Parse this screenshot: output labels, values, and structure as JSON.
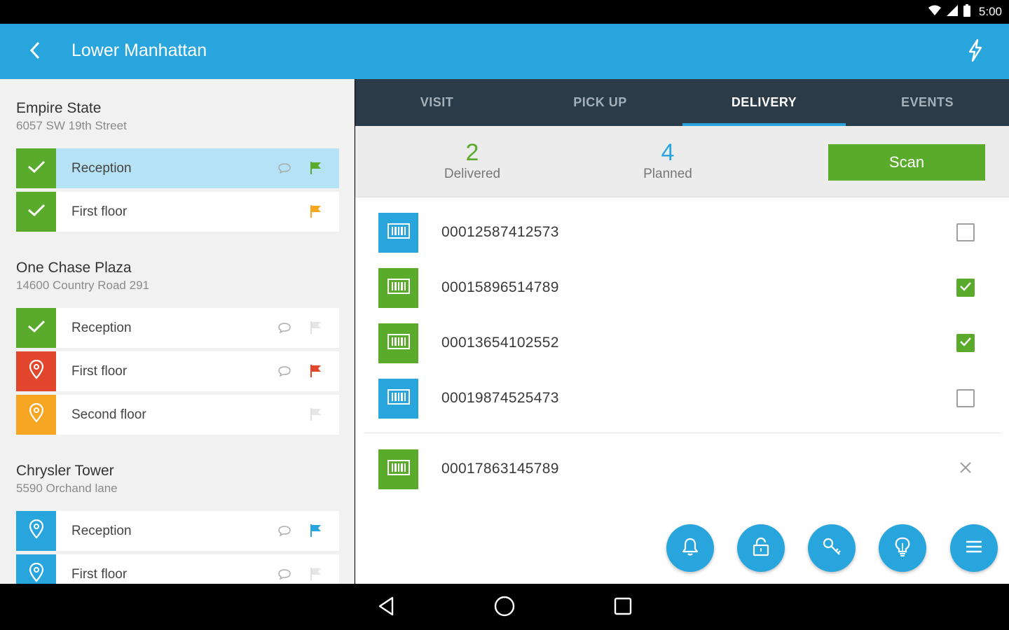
{
  "status_bar": {
    "time": "5:00"
  },
  "app_bar": {
    "title": "Lower Manhattan",
    "back_icon": "chevron-left-icon",
    "action_icon": "bolt-icon"
  },
  "colors": {
    "primary": "#29a5de",
    "success": "#5aaa2b",
    "danger": "#e2462c",
    "warning": "#f6a623",
    "tab_bar": "#2b3b48"
  },
  "locations": [
    {
      "name": "Empire State",
      "address": "6057 SW 19th Street",
      "stops": [
        {
          "label": "Reception",
          "status": "done",
          "comment": true,
          "flag": "green",
          "selected": true
        },
        {
          "label": "First floor",
          "status": "done",
          "comment": false,
          "flag": "orange",
          "selected": false
        }
      ]
    },
    {
      "name": "One Chase Plaza",
      "address": "14600 Country Road 291",
      "stops": [
        {
          "label": "Reception",
          "status": "done",
          "comment": true,
          "flag": "grey",
          "selected": false
        },
        {
          "label": "First floor",
          "status": "red-pin",
          "comment": true,
          "flag": "red",
          "selected": false
        },
        {
          "label": "Second floor",
          "status": "orange-pin",
          "comment": false,
          "flag": "grey",
          "selected": false
        }
      ]
    },
    {
      "name": "Chrysler Tower",
      "address": "5590 Orchand lane",
      "stops": [
        {
          "label": "Reception",
          "status": "blue-pin",
          "comment": true,
          "flag": "blue",
          "selected": false
        },
        {
          "label": "First floor",
          "status": "blue-pin",
          "comment": true,
          "flag": "grey",
          "selected": false
        }
      ]
    }
  ],
  "tabs": [
    {
      "label": "VISIT",
      "active": false
    },
    {
      "label": "PICK UP",
      "active": false
    },
    {
      "label": "DELIVERY",
      "active": true
    },
    {
      "label": "EVENTS",
      "active": false
    }
  ],
  "summary": {
    "delivered_count": "2",
    "delivered_label": "Delivered",
    "planned_count": "4",
    "planned_label": "Planned",
    "scan_label": "Scan"
  },
  "parcels": [
    {
      "code": "00012587412573",
      "color": "blue",
      "control": "checkbox",
      "checked": false
    },
    {
      "code": "00015896514789",
      "color": "green",
      "control": "checkbox",
      "checked": true
    },
    {
      "code": "00013654102552",
      "color": "green",
      "control": "checkbox",
      "checked": true
    },
    {
      "code": "00019874525473",
      "color": "blue",
      "control": "checkbox",
      "checked": false
    },
    {
      "code": "00017863145789",
      "color": "green",
      "control": "remove",
      "checked": false
    }
  ],
  "fabs": [
    "bell-icon",
    "unlock-icon",
    "key-icon",
    "lightbulb-icon",
    "menu-icon"
  ],
  "nav": [
    "back-triangle-icon",
    "home-circle-icon",
    "recents-square-icon"
  ]
}
